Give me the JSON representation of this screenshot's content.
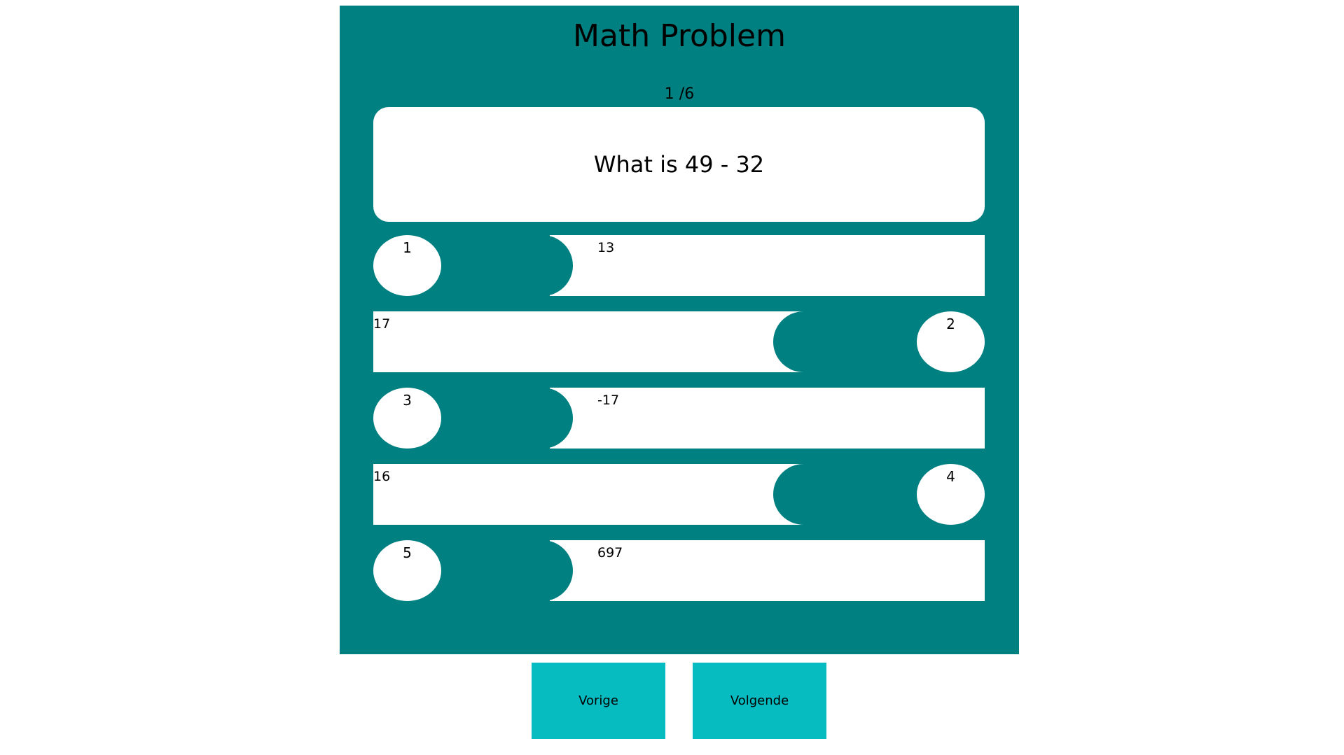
{
  "title": "Math Problem",
  "progress": "1 /6",
  "question": "What is 49 - 32",
  "answers": [
    {
      "number": "1",
      "text": "13"
    },
    {
      "number": "2",
      "text": "17"
    },
    {
      "number": "3",
      "text": "-17"
    },
    {
      "number": "4",
      "text": "16"
    },
    {
      "number": "5",
      "text": "697"
    }
  ],
  "buttons": {
    "previous": "Vorige",
    "next": "Volgende"
  },
  "colors": {
    "panel": "#008080",
    "card": "#ffffff",
    "button": "#06bcc1"
  }
}
